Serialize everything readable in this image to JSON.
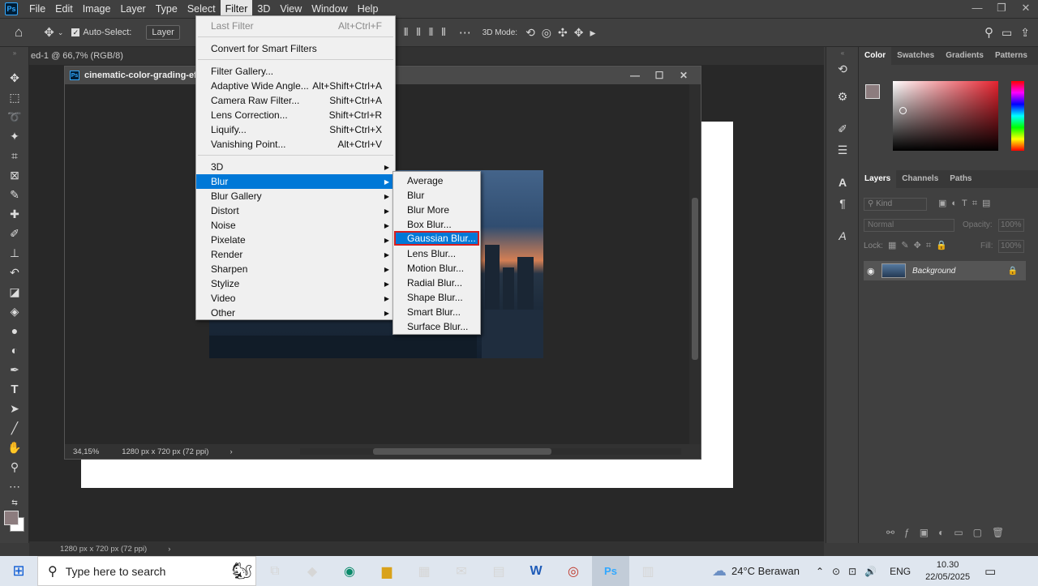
{
  "menubar": {
    "items": [
      "File",
      "Edit",
      "Image",
      "Layer",
      "Type",
      "Select",
      "Filter",
      "3D",
      "View",
      "Window",
      "Help"
    ],
    "active": "Filter"
  },
  "options": {
    "auto_select": "Auto-Select:",
    "layer_dropdown": "Layer",
    "mode_3d": "3D Mode:"
  },
  "doc_tab": "ed-1 @ 66,7% (RGB/8)",
  "doc_window": {
    "title": "cinematic-color-grading-effe",
    "zoom": "34,15%",
    "dims": "1280 px x 720 px (72 ppi)"
  },
  "bottom_status": "1280 px x 720 px (72 ppi)",
  "filter_menu": {
    "last_filter": "Last Filter",
    "last_filter_sc": "Alt+Ctrl+F",
    "convert": "Convert for Smart Filters",
    "gallery": "Filter Gallery...",
    "adaptive": "Adaptive Wide Angle...",
    "adaptive_sc": "Alt+Shift+Ctrl+A",
    "camera_raw": "Camera Raw Filter...",
    "camera_raw_sc": "Shift+Ctrl+A",
    "lens_corr": "Lens Correction...",
    "lens_corr_sc": "Shift+Ctrl+R",
    "liquify": "Liquify...",
    "liquify_sc": "Shift+Ctrl+X",
    "vanishing": "Vanishing Point...",
    "vanishing_sc": "Alt+Ctrl+V",
    "sub": [
      "3D",
      "Blur",
      "Blur Gallery",
      "Distort",
      "Noise",
      "Pixelate",
      "Render",
      "Sharpen",
      "Stylize",
      "Video",
      "Other"
    ]
  },
  "blur_submenu": [
    "Average",
    "Blur",
    "Blur More",
    "Box Blur...",
    "Gaussian Blur...",
    "Lens Blur...",
    "Motion Blur...",
    "Radial Blur...",
    "Shape Blur...",
    "Smart Blur...",
    "Surface Blur..."
  ],
  "color_panel": {
    "tabs": [
      "Color",
      "Swatches",
      "Gradients",
      "Patterns"
    ]
  },
  "layers_panel": {
    "tabs": [
      "Layers",
      "Channels",
      "Paths"
    ],
    "kind": "Kind",
    "blend": "Normal",
    "opacity_label": "Opacity:",
    "opacity_val": "100%",
    "lock_label": "Lock:",
    "fill_label": "Fill:",
    "fill_val": "100%",
    "layer_name": "Background"
  },
  "taskbar": {
    "search_placeholder": "Type here to search",
    "weather": "24°C  Berawan",
    "lang": "ENG",
    "time": "10.30",
    "date": "22/05/2025"
  },
  "colors": {
    "highlight": "#0078d7",
    "outline": "#d81e1e"
  }
}
